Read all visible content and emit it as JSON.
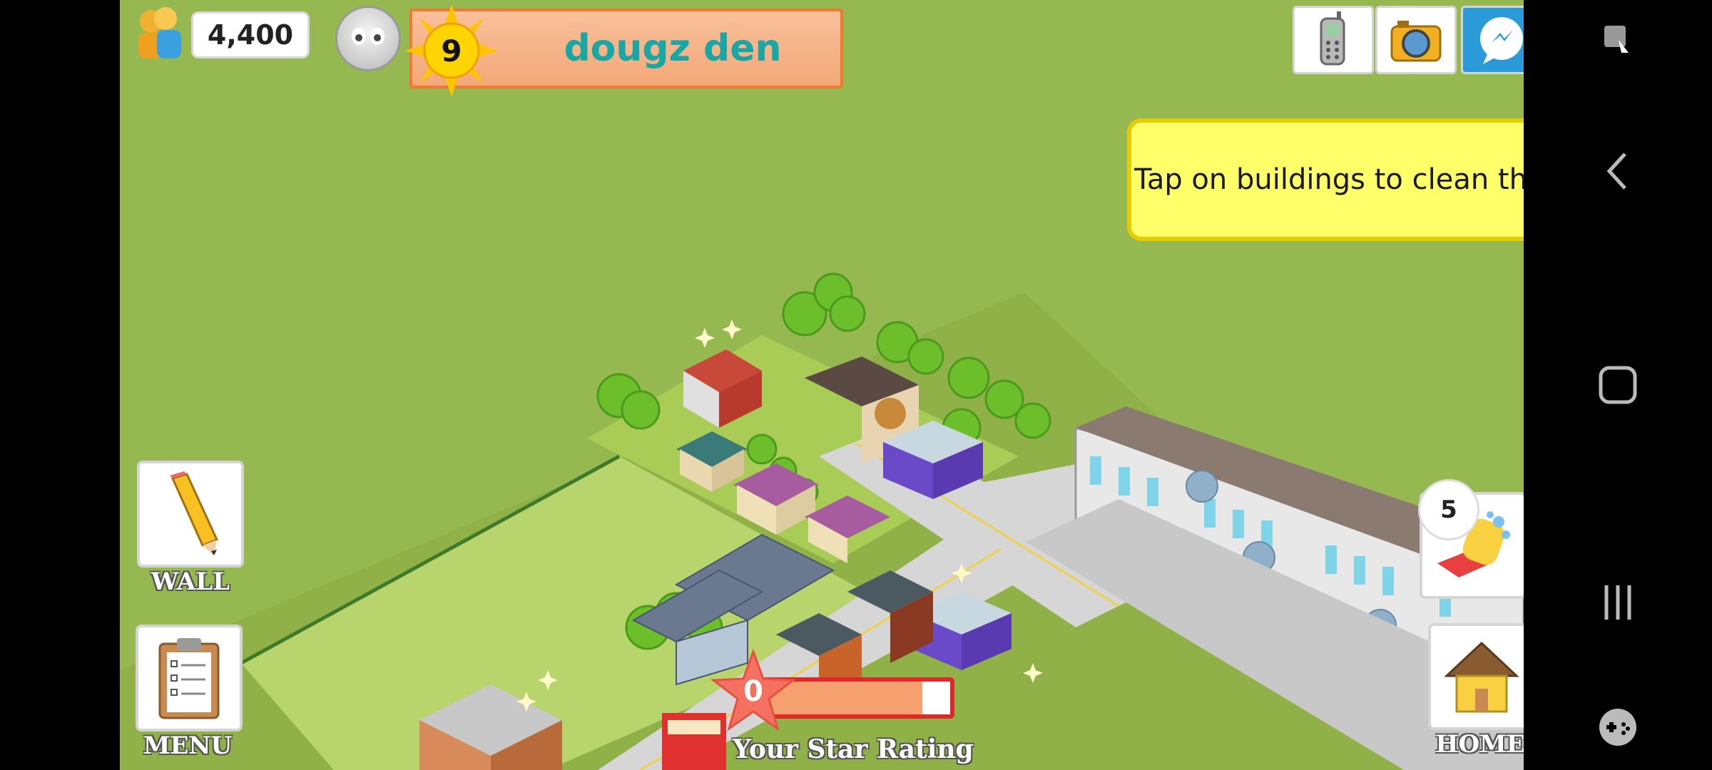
{
  "hud": {
    "coins": "4,400",
    "level": "9",
    "town_name": "dougz den"
  },
  "top_buttons": [
    {
      "name": "phone-icon"
    },
    {
      "name": "camera-icon"
    },
    {
      "name": "messenger-icon"
    }
  ],
  "tooltip": {
    "text": "Tap on buildings to clean them."
  },
  "left_menu": {
    "wall_label": "WALL",
    "menu_label": "MENU"
  },
  "right_menu": {
    "clean_count": "5",
    "home_label": "HOME"
  },
  "star_rating": {
    "value": "0",
    "label": "Your Star Rating",
    "progress": 0.85
  },
  "system_nav": {
    "items": [
      "screen-capture-icon",
      "back-icon",
      "home-icon",
      "recents-icon",
      "game-launcher-icon"
    ]
  },
  "colors": {
    "grass": "#96b850",
    "lot": "#b7d46d",
    "level_bar": "#f3a878",
    "town_name": "#19a6a6",
    "tooltip": "#ffff6a",
    "star_border": "#e02828"
  }
}
